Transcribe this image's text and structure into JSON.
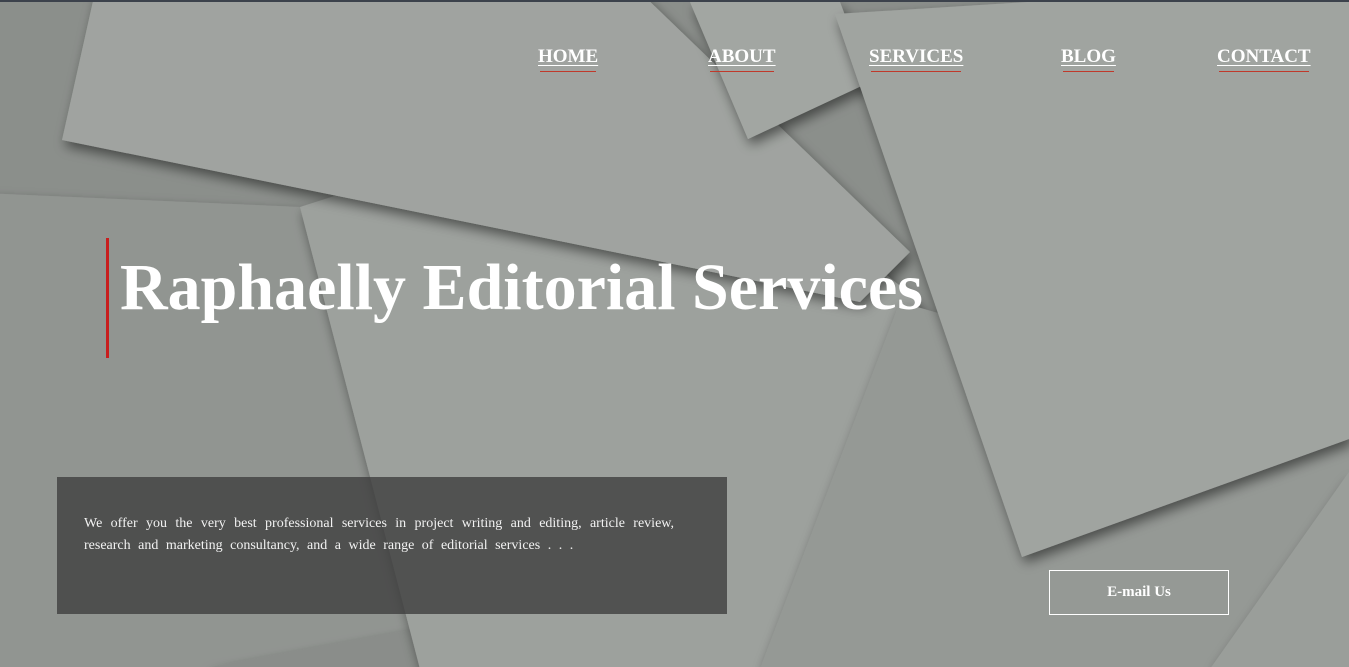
{
  "nav": {
    "items": [
      {
        "label": "HOME"
      },
      {
        "label": "ABOUT"
      },
      {
        "label": "SERVICES"
      },
      {
        "label": "BLOG"
      },
      {
        "label": "CONTACT"
      }
    ]
  },
  "hero": {
    "title": "Raphaelly Editorial Services",
    "description": "We offer you the very best professional services in project writing and editing, article review, research and marketing consultancy, and a wide range of editorial services . . .",
    "email_button_label": "E-mail Us"
  },
  "colors": {
    "accent": "#c81e1e",
    "text": "#ffffff",
    "overlay": "#3c3c3c",
    "background": "#9a9d9a"
  }
}
